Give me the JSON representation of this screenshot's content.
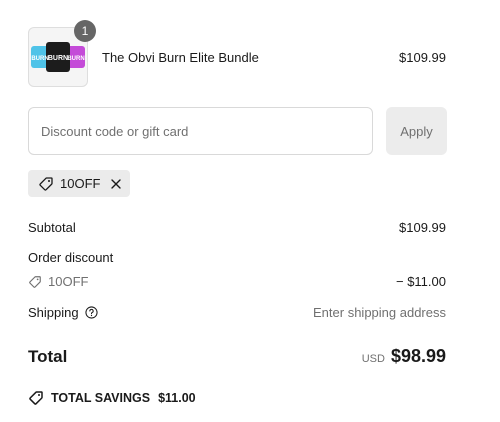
{
  "cart": {
    "item": {
      "name": "The Obvi Burn Elite Bundle",
      "price": "$109.99",
      "quantity": "1",
      "thumbnail_labels": [
        "BURN",
        "BURN",
        "BURN"
      ]
    }
  },
  "discount": {
    "placeholder": "Discount code or gift card",
    "value": "",
    "apply_label": "Apply",
    "applied_code": "10OFF"
  },
  "summary": {
    "subtotal_label": "Subtotal",
    "subtotal_value": "$109.99",
    "order_discount_label": "Order discount",
    "discount_code": "10OFF",
    "discount_value": "− $11.00",
    "shipping_label": "Shipping",
    "shipping_value": "Enter shipping address",
    "total_label": "Total",
    "currency": "USD",
    "total_value": "$98.99",
    "savings_label": "TOTAL SAVINGS",
    "savings_value": "$11.00"
  },
  "icons": {
    "tag": "tag-icon",
    "remove": "close-icon",
    "help": "help-circle-icon"
  },
  "colors": {
    "text": "#1a1a1a",
    "muted": "#707070",
    "chip_bg": "#ebebeb",
    "badge": "#666666",
    "apply_bg": "#ececec"
  }
}
